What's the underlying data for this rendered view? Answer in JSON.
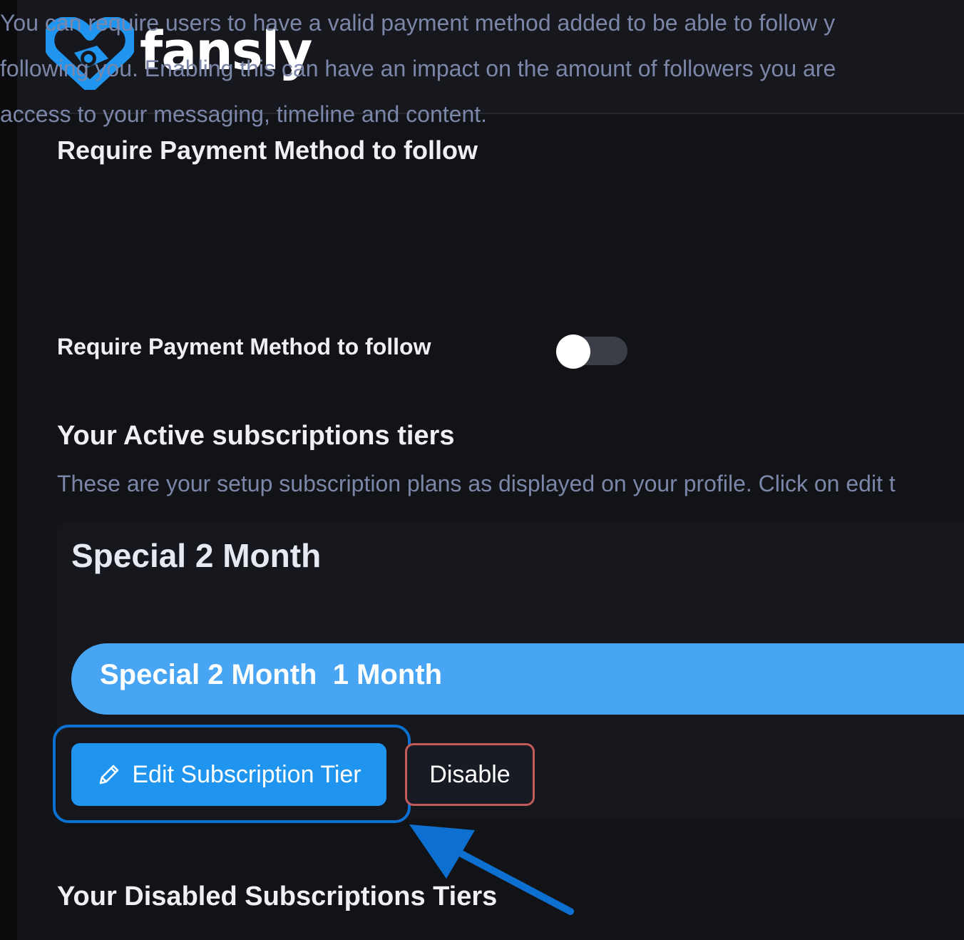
{
  "brand": {
    "name": "fansly",
    "logo_icon": "heart-camera-logo-icon",
    "accent": "#1f95f0"
  },
  "require_payment": {
    "title": "Require Payment Method to follow",
    "description_lines": [
      "You can require users to have a valid payment method added to be able to follow y",
      "following you. Enabling this can have an impact on the amount of followers you are",
      "access to your messaging, timeline and content."
    ],
    "toggle_label": "Require Payment Method to follow",
    "toggle_on": false
  },
  "active_tiers": {
    "title": "Your Active subscriptions tiers",
    "description": "These are your setup subscription plans as displayed on your profile. Click on edit t",
    "tiers": [
      {
        "name": "Special 2 Month",
        "bar_label": "Special 2 Month  1 Month",
        "edit_label": "Edit Subscription Tier",
        "disable_label": "Disable"
      }
    ]
  },
  "disabled_tiers": {
    "title": "Your Disabled Subscriptions Tiers"
  },
  "annotation": {
    "highlight_color": "#0d6fd0"
  }
}
